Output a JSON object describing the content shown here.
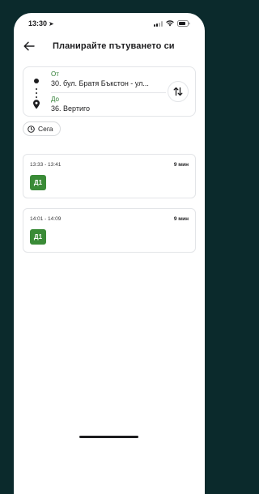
{
  "status_bar": {
    "time": "13:30",
    "location_icon": "location-arrow-icon"
  },
  "header": {
    "title": "Планирайте пътуването си",
    "back_icon": "arrow-left-icon"
  },
  "route": {
    "from_label": "От",
    "from_value": "30. бул. Братя Бъкстон - ул...",
    "to_label": "До",
    "to_value": "36. Вертиго",
    "swap_icon": "swap-vertical-icon"
  },
  "time_chip": {
    "label": "Сега",
    "icon": "clock-icon"
  },
  "trips": [
    {
      "time_range": "13:33 - 13:41",
      "duration": "9 мин",
      "line": "Д1"
    },
    {
      "time_range": "14:01 - 14:09",
      "duration": "9 мин",
      "line": "Д1"
    }
  ],
  "colors": {
    "background": "#0b2a2c",
    "accent_green": "#3a8b37",
    "label_green": "#2e7d32",
    "border": "#e3e5e8"
  }
}
